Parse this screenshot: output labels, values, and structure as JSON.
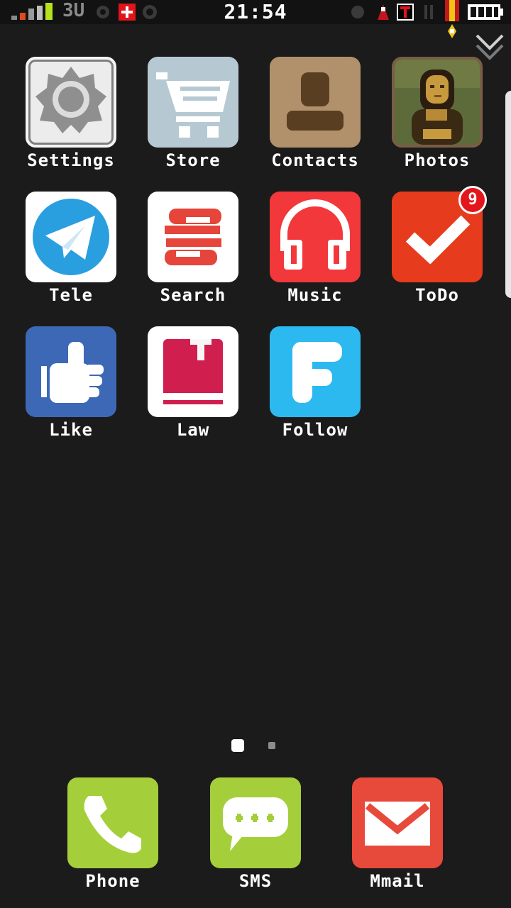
{
  "status": {
    "time": "21:54",
    "network": "3U",
    "signal_icon": "signal-bars-icon",
    "battery_icon": "battery-icon"
  },
  "apps": [
    {
      "label": "Settings",
      "icon": "settings-gear-icon",
      "color": "#dcdcdc"
    },
    {
      "label": "Store",
      "icon": "shopping-cart-icon",
      "color": "#b6c9d3"
    },
    {
      "label": "Contacts",
      "icon": "contact-person-icon",
      "color": "#b0916b"
    },
    {
      "label": "Photos",
      "icon": "mona-lisa-photo-icon",
      "color": "#6b5a3c"
    },
    {
      "label": "Tele",
      "icon": "telegram-plane-icon",
      "color": "#2a9fe0"
    },
    {
      "label": "Search",
      "icon": "search-s-icon",
      "color": "#e5453a"
    },
    {
      "label": "Music",
      "icon": "headphones-icon",
      "color": "#f2383a"
    },
    {
      "label": "ToDo",
      "icon": "checkmark-icon",
      "color": "#e63c1d",
      "badge": "9"
    },
    {
      "label": "Like",
      "icon": "thumbs-up-icon",
      "color": "#3d68b6"
    },
    {
      "label": "Law",
      "icon": "book-icon",
      "color": "#d01e4f"
    },
    {
      "label": "Follow",
      "icon": "follow-f-icon",
      "color": "#2cb9f0"
    }
  ],
  "dock": [
    {
      "label": "Phone",
      "icon": "phone-handset-icon",
      "color": "#a4cf3b"
    },
    {
      "label": "SMS",
      "icon": "sms-bubble-icon",
      "color": "#a4cf3b"
    },
    {
      "label": "Mmail",
      "icon": "mail-envelope-icon",
      "color": "#e74a3b"
    }
  ],
  "pages": {
    "count": 2,
    "current": 1
  }
}
